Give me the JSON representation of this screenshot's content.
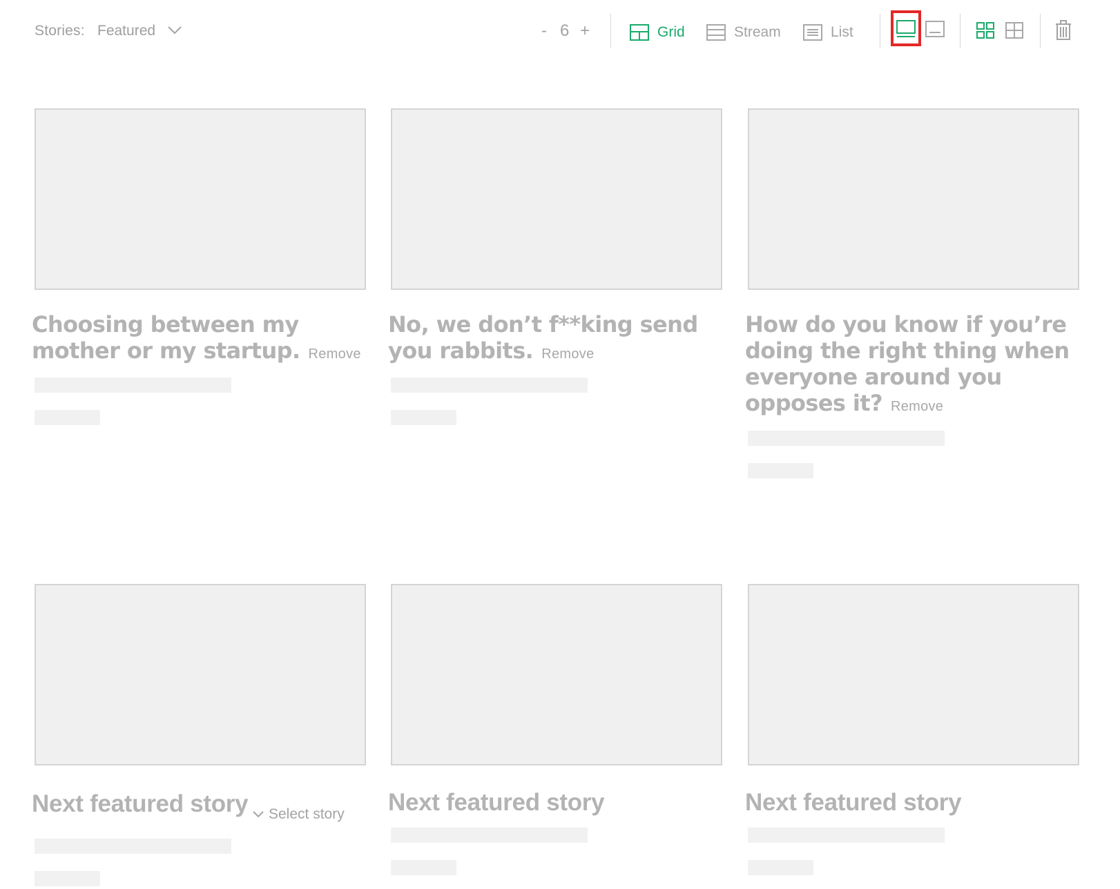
{
  "toolbar": {
    "stories_label": "Stories:",
    "stories_value": "Featured",
    "count": {
      "minus": "-",
      "value": "6",
      "plus": "+"
    },
    "views": [
      {
        "label": "Grid",
        "icon": "grid-layout-icon",
        "active": true
      },
      {
        "label": "Stream",
        "icon": "stream-layout-icon",
        "active": false
      },
      {
        "label": "List",
        "icon": "list-layout-icon",
        "active": false
      }
    ],
    "image_position_icons": [
      "image-above-icon",
      "image-below-icon"
    ],
    "column_icons": [
      "four-grid-icon",
      "two-by-two-table-icon"
    ],
    "delete_icon": "trash-icon"
  },
  "stories": [
    {
      "title": "Choosing between my mother or my startup.",
      "remove": "Remove"
    },
    {
      "title": "No, we don’t f**king send you rabbits.",
      "remove": "Remove"
    },
    {
      "title": "How do you know if you’re doing the right thing when everyone around you opposes it?",
      "remove": "Remove"
    }
  ],
  "placeholders": [
    {
      "title": "Next featured story",
      "select": "Select story"
    },
    {
      "title": "Next featured story"
    },
    {
      "title": "Next featured story"
    }
  ],
  "colors": {
    "accent": "#1aaa6b",
    "highlight": "#e42727",
    "placeholder_gray": "#f0f0f0",
    "text_gray": "#b3b3b3"
  }
}
